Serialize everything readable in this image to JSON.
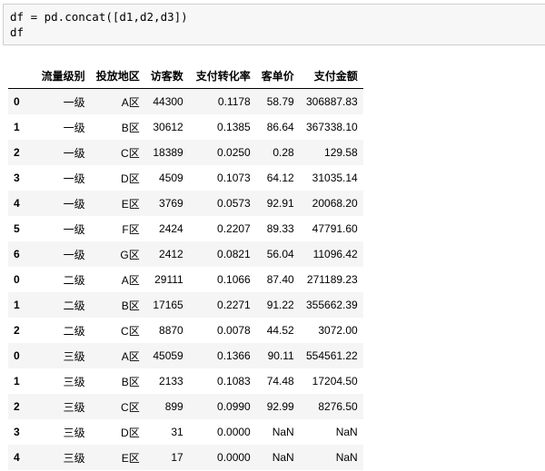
{
  "input_cell": {
    "code_lines": [
      "df = pd.concat([d1,d2,d3])",
      "df"
    ]
  },
  "table": {
    "columns": [
      "",
      "流量级别",
      "投放地区",
      "访客数",
      "支付转化率",
      "客单价",
      "支付金额"
    ],
    "rows": [
      {
        "index": "0",
        "cells": [
          "一级",
          "A区",
          "44300",
          "0.1178",
          "58.79",
          "306887.83"
        ]
      },
      {
        "index": "1",
        "cells": [
          "一级",
          "B区",
          "30612",
          "0.1385",
          "86.64",
          "367338.10"
        ]
      },
      {
        "index": "2",
        "cells": [
          "一级",
          "C区",
          "18389",
          "0.0250",
          "0.28",
          "129.58"
        ]
      },
      {
        "index": "3",
        "cells": [
          "一级",
          "D区",
          "4509",
          "0.1073",
          "64.12",
          "31035.14"
        ]
      },
      {
        "index": "4",
        "cells": [
          "一级",
          "E区",
          "3769",
          "0.0573",
          "92.91",
          "20068.20"
        ]
      },
      {
        "index": "5",
        "cells": [
          "一级",
          "F区",
          "2424",
          "0.2207",
          "89.33",
          "47791.60"
        ]
      },
      {
        "index": "6",
        "cells": [
          "一级",
          "G区",
          "2412",
          "0.0821",
          "56.04",
          "11096.42"
        ]
      },
      {
        "index": "0",
        "cells": [
          "二级",
          "A区",
          "29111",
          "0.1066",
          "87.40",
          "271189.23"
        ]
      },
      {
        "index": "1",
        "cells": [
          "二级",
          "B区",
          "17165",
          "0.2271",
          "91.22",
          "355662.39"
        ]
      },
      {
        "index": "2",
        "cells": [
          "二级",
          "C区",
          "8870",
          "0.0078",
          "44.52",
          "3072.00"
        ]
      },
      {
        "index": "0",
        "cells": [
          "三级",
          "A区",
          "45059",
          "0.1366",
          "90.11",
          "554561.22"
        ]
      },
      {
        "index": "1",
        "cells": [
          "三级",
          "B区",
          "2133",
          "0.1083",
          "74.48",
          "17204.50"
        ]
      },
      {
        "index": "2",
        "cells": [
          "三级",
          "C区",
          "899",
          "0.0990",
          "92.99",
          "8276.50"
        ]
      },
      {
        "index": "3",
        "cells": [
          "三级",
          "D区",
          "31",
          "0.0000",
          "NaN",
          "NaN"
        ]
      },
      {
        "index": "4",
        "cells": [
          "三级",
          "E区",
          "17",
          "0.0000",
          "NaN",
          "NaN"
        ]
      }
    ]
  }
}
